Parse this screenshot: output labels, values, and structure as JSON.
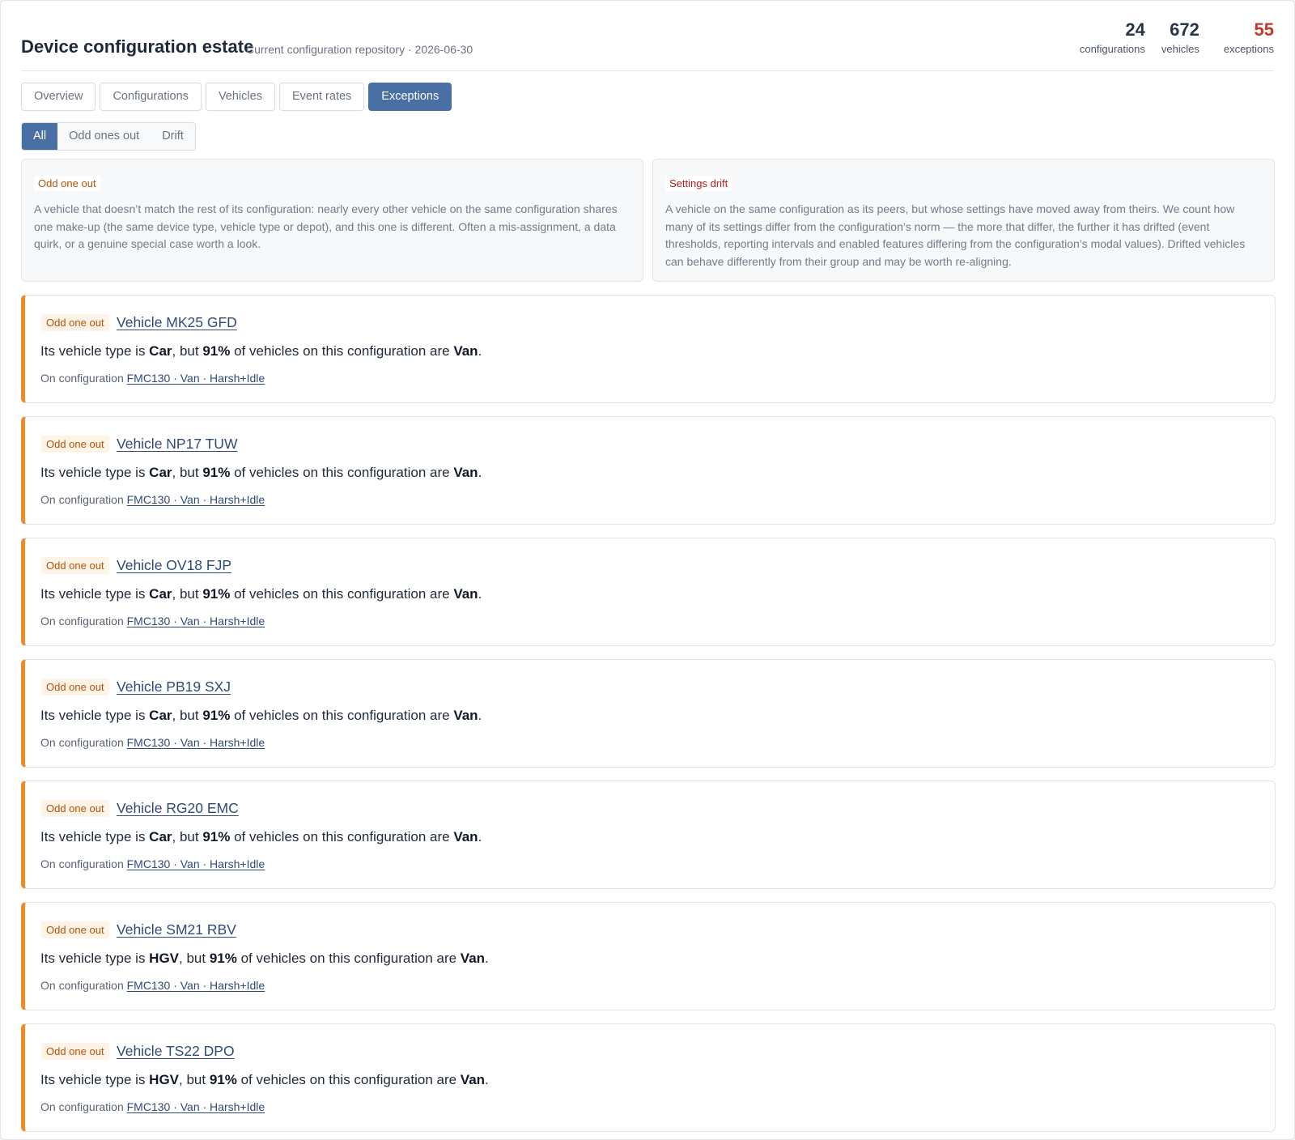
{
  "header": {
    "title": "Device configuration estate",
    "subtitle": "Current configuration repository · 2026-06-30",
    "stats": [
      {
        "value": "24",
        "label": "configurations"
      },
      {
        "value": "672",
        "label": "vehicles"
      },
      {
        "value": "55",
        "label": "exceptions"
      }
    ]
  },
  "tabs": [
    "Overview",
    "Configurations",
    "Vehicles",
    "Event rates",
    "Exceptions"
  ],
  "active_tab": "Exceptions",
  "filters": [
    "All",
    "Odd ones out",
    "Drift"
  ],
  "active_filter": "All",
  "info": {
    "odd": {
      "tag": "Odd one out",
      "text": "A vehicle that doesn’t match the rest of its configuration: nearly every other vehicle on the same configuration shares one make-up (the same device type, vehicle type or depot), and this one is different. Often a mis-assignment, a data quirk, or a genuine special case worth a look."
    },
    "drift": {
      "tag": "Settings drift",
      "text": "A vehicle on the same configuration as its peers, but whose settings have moved away from theirs. We count how many of its settings differ from the configuration’s norm — the more that differ, the further it has drifted (event thresholds, reporting intervals and enabled features differing from the configuration’s modal values). Drifted vehicles can behave differently from their group and may be worth re-aligning."
    }
  },
  "common": {
    "badge": "Odd one out",
    "prefix": "Its vehicle type is ",
    "mid1": ", but ",
    "mid2": " of vehicles on this configuration are ",
    "end": ".",
    "on_config": "On configuration ",
    "config_name": "FMC130 · Van · Harsh+Idle"
  },
  "exceptions": [
    {
      "vehicle": "Vehicle MK25 GFD",
      "type": "Car",
      "pct": "91%",
      "majority": "Van"
    },
    {
      "vehicle": "Vehicle NP17 TUW",
      "type": "Car",
      "pct": "91%",
      "majority": "Van"
    },
    {
      "vehicle": "Vehicle OV18 FJP",
      "type": "Car",
      "pct": "91%",
      "majority": "Van"
    },
    {
      "vehicle": "Vehicle PB19 SXJ",
      "type": "Car",
      "pct": "91%",
      "majority": "Van"
    },
    {
      "vehicle": "Vehicle RG20 EMC",
      "type": "Car",
      "pct": "91%",
      "majority": "Van"
    },
    {
      "vehicle": "Vehicle SM21 RBV",
      "type": "HGV",
      "pct": "91%",
      "majority": "Van"
    },
    {
      "vehicle": "Vehicle TS22 DPO",
      "type": "HGV",
      "pct": "91%",
      "majority": "Van"
    }
  ],
  "colors": {
    "accent": "#4a6fa5",
    "exception_red": "#c0392b",
    "odd_orange": "#f08a24"
  }
}
